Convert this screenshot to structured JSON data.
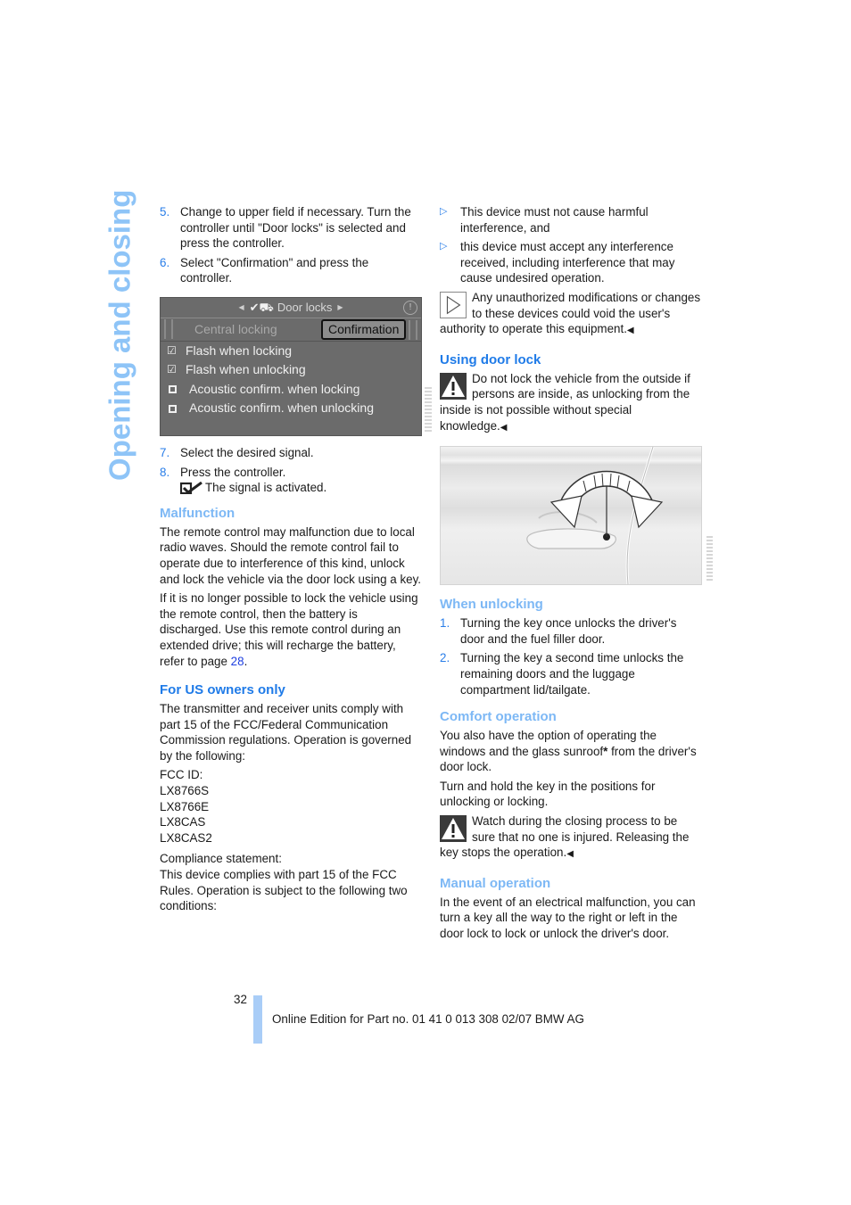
{
  "side_title": "Opening and closing",
  "left": {
    "steps_a": [
      {
        "num": "5.",
        "text": "Change to upper field if necessary. Turn the controller until \"Door locks\" is selected and press the controller."
      },
      {
        "num": "6.",
        "text": "Select \"Confirmation\" and press the controller."
      }
    ],
    "screen": {
      "menu_title": "Door locks",
      "tabs": {
        "inactive": "Central locking",
        "active": "Confirmation"
      },
      "options": [
        {
          "label": "Flash when locking",
          "checked": true
        },
        {
          "label": "Flash when unlocking",
          "checked": true
        },
        {
          "label": "Acoustic confirm. when locking",
          "checked": false
        },
        {
          "label": "Acoustic confirm. when unlocking",
          "checked": false
        }
      ]
    },
    "steps_b": [
      {
        "num": "7.",
        "text": "Select the desired signal."
      },
      {
        "num": "8.",
        "text": "Press the controller."
      }
    ],
    "signal_activated": "The signal is activated.",
    "malfunction": {
      "heading": "Malfunction",
      "p1": "The remote control may malfunction due to local radio waves. Should the remote control fail to operate due to interference of this kind, unlock and lock the vehicle via the door lock using a key.",
      "p2_pre": "If it is no longer possible to lock the vehicle using the remote control, then the battery is discharged. Use this remote control during an extended drive; this will recharge the battery, refer to page ",
      "p2_link": "28",
      "p2_post": "."
    },
    "us_owners": {
      "heading": "For US owners only",
      "p1": "The transmitter and receiver units comply with part 15 of the FCC/Federal Communication Commission regulations. Operation is governed by the following:",
      "fcc_label": "FCC ID:",
      "fcc_ids": [
        "LX8766S",
        "LX8766E",
        "LX8CAS",
        "LX8CAS2"
      ],
      "compliance_label": "Compliance statement:",
      "compliance_text": "This device complies with part 15 of the FCC Rules. Operation is subject to the following two conditions:"
    }
  },
  "right": {
    "conditions": [
      "This device must not cause harmful interference, and",
      "this device must accept any interference received, including interference that may cause undesired operation."
    ],
    "note_unauthorized": "Any unauthorized modifications or changes to these devices could void the user's authority to operate this equipment.",
    "door_lock": {
      "heading": "Using door lock",
      "warning": "Do not lock the vehicle from the outside if persons are inside, as unlocking from the inside is not possible without special knowledge."
    },
    "unlocking": {
      "heading": "When unlocking",
      "steps": [
        {
          "num": "1.",
          "text": "Turning the key once unlocks the driver's door and the fuel filler door."
        },
        {
          "num": "2.",
          "text": "Turning the key a second time unlocks the remaining doors and the luggage compartment lid/tailgate."
        }
      ]
    },
    "comfort": {
      "heading": "Comfort operation",
      "p1_pre": "You also have the option of operating the windows and the glass sunroof",
      "p1_star": "*",
      "p1_post": " from the driver's door lock.",
      "p2": "Turn and hold the key in the positions for unlocking or locking.",
      "warning": "Watch during the closing process to be sure that no one is injured. Releasing the key stops the operation."
    },
    "manual": {
      "heading": "Manual operation",
      "p1": "In the event of an electrical malfunction, you can turn a key all the way to the right or left in the door lock to lock or unlock the driver's door."
    }
  },
  "footer": {
    "page_number": "32",
    "edition": "Online Edition for Part no. 01 41 0 013 308 02/07 BMW AG"
  },
  "colors": {
    "accent": "#1f7be8",
    "accent_light": "#7db8f5",
    "side_title": "#8ec4f7",
    "footer_bar": "#a9cdf7",
    "link": "#1e3fe0"
  }
}
